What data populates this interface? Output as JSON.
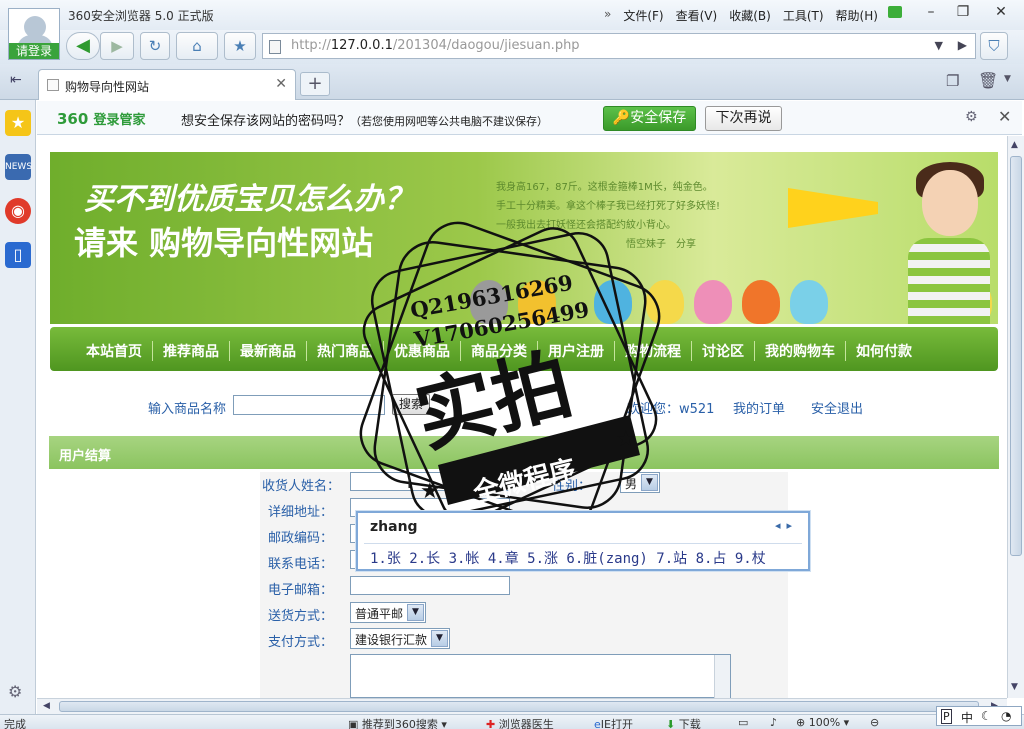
{
  "window": {
    "app_title": "360安全浏览器 5.0 正式版",
    "login_label": "请登录",
    "menu": [
      "文件(F)",
      "查看(V)",
      "收藏(B)",
      "工具(T)",
      "帮助(H)"
    ],
    "minimize": "–",
    "restore": "❐",
    "close": "✕"
  },
  "navigation": {
    "url_prefix": "http://",
    "url_host": "127.0.0.1",
    "url_path": "/201304/daogou/jiesuan.php"
  },
  "tab": {
    "label": "购物导向性网站",
    "new_tab": "+"
  },
  "password_bar": {
    "logo": "360",
    "logo_sub": "登录管家",
    "prompt": "想安全保存该网站的密码吗？",
    "note": "（若您使用网吧等公共电脑不建议保存）",
    "save_label": "安全保存",
    "later_label": "下次再说"
  },
  "banner": {
    "line1": "买不到优质宝贝怎么办？",
    "line2": "请来 购物导向性网站",
    "quote_lines": [
      "我身高167，87斤。这根金箍棒1M长，纯金色。",
      "手工十分精美。拿这个棒子我已经打死了好多妖怪!",
      "一般我出去打妖怪还会搭配约紋小背心。",
      "悟空妹子　分享"
    ]
  },
  "topnav": [
    "本站首页",
    "推荐商品",
    "最新商品",
    "热门商品",
    "优惠商品",
    "商品分类",
    "用户注册",
    "购物流程",
    "讨论区",
    "我的购物车",
    "如何付款"
  ],
  "search": {
    "label": "输入商品名称",
    "button": "搜索",
    "welcome": "欢迎您：w521",
    "my_orders": "我的订单",
    "logout": "安全退出"
  },
  "section_title": "用户结算",
  "form": {
    "name_label": "收货人姓名：",
    "gender_label": "性别：",
    "gender_value": "男",
    "address_label": "详细地址：",
    "zip_label": "邮政编码：",
    "phone_label": "联系电话：",
    "email_label": "电子邮箱：",
    "shipping_label": "送货方式：",
    "shipping_value": "普通平邮",
    "payment_label": "支付方式：",
    "payment_value": "建设银行汇款"
  },
  "ime": {
    "composition": "zhang",
    "candidates": "1.张 2.长 3.帐 4.章 5.涨 6.脏(zang) 7.站 8.占 9.杖",
    "tray": "中"
  },
  "watermark": {
    "line1": "Q2196316269",
    "line2": "V17060256499",
    "main": "实拍",
    "sub": "全微程序"
  },
  "status": {
    "left": "完成",
    "share": "推荐到360搜索",
    "doctor": "浏览器医生",
    "ie": "IE打开",
    "download": "下载",
    "zoom": "100%"
  },
  "colors": {
    "brand_green": "#3cae3a",
    "nav_green": "#5fa62a",
    "link_blue": "#2a60a8"
  }
}
